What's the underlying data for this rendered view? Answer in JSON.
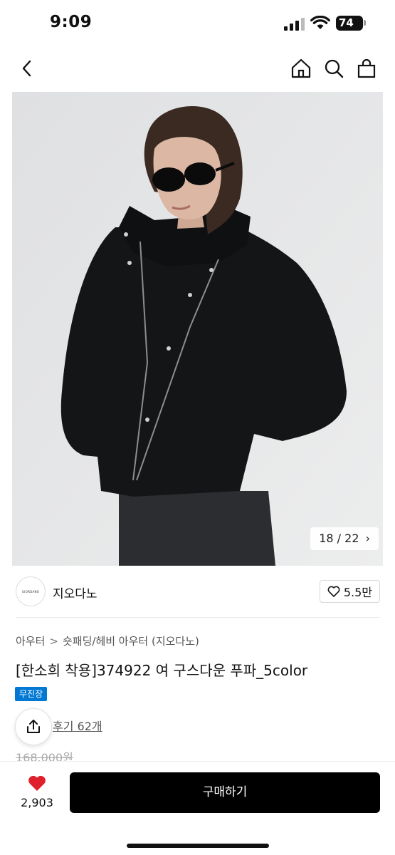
{
  "status_bar": {
    "time": "9:09",
    "battery": "74"
  },
  "nav": {
    "back_icon": "chevron-left-icon",
    "home_icon": "home-icon",
    "search_icon": "search-icon",
    "cart_icon": "shopping-bag-icon"
  },
  "gallery": {
    "counter": "18 / 22",
    "next_arrow": "›"
  },
  "brand": {
    "logo_text": "GIORDANO",
    "name": "지오다노",
    "like_count": "5.5만"
  },
  "breadcrumb": {
    "level1": "아우터",
    "separator": ">",
    "level2": "숏패딩/헤비 아우터 (지오다노)"
  },
  "product": {
    "title": "[한소희 착용]374922 여 구스다운 푸파_5color",
    "badge": "무진장",
    "reviews": "후기 62개",
    "original_price": "168,000원"
  },
  "bottom_bar": {
    "wish_count": "2,903",
    "buy_label": "구매하기"
  },
  "colors": {
    "accent": "#0078d4",
    "heart": "#e0202c",
    "buy_button": "#000000"
  }
}
